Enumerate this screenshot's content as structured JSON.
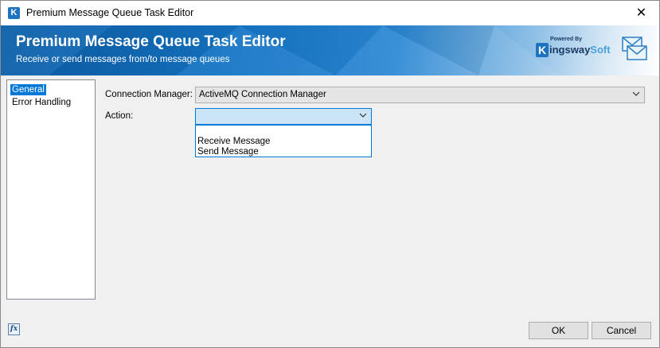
{
  "window": {
    "title": "Premium Message Queue Task Editor",
    "close_glyph": "✕"
  },
  "banner": {
    "title": "Premium Message Queue Task Editor",
    "subtitle": "Receive or send messages from/to message queues",
    "logo_powered": "Powered By",
    "logo_k": "K",
    "logo_main": "ingsway",
    "logo_soft": "Soft"
  },
  "nav": {
    "items": [
      {
        "label": "General",
        "selected": true
      },
      {
        "label": "Error Handling",
        "selected": false
      }
    ]
  },
  "form": {
    "connection_manager": {
      "label": "Connection Manager:",
      "value": "ActiveMQ Connection Manager"
    },
    "action": {
      "label": "Action:",
      "value": "",
      "options": [
        "Receive Message",
        "Send Message"
      ]
    }
  },
  "footer": {
    "fx_label": "fx",
    "ok_label": "OK",
    "cancel_label": "Cancel"
  },
  "icons": {
    "app": "kingswaysoft-icon",
    "mail": "mail-stack-icon",
    "chevron": "chevron-down-icon",
    "expression": "fx-expression-icon"
  },
  "colors": {
    "banner_blue": "#1574c4",
    "selection": "#0078d7",
    "focus_fill": "#cce4f7"
  }
}
